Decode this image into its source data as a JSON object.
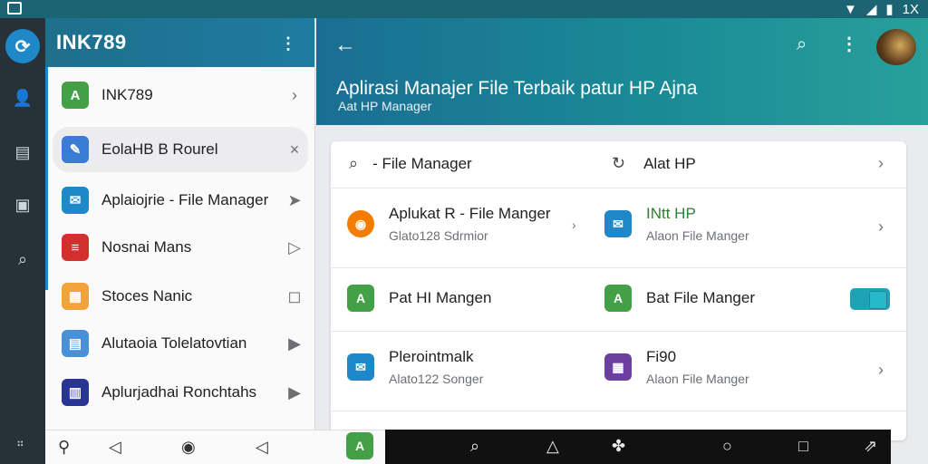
{
  "status_bar": {
    "icons": [
      "image-icon",
      "wifi-icon",
      "signal-icon",
      "battery-icon",
      "close-icon"
    ],
    "right_text": "1X"
  },
  "drawer": {
    "title": "INK789",
    "items": [
      {
        "label": "INK789",
        "icon": "android-icon",
        "color": "#43a047",
        "trail": "›"
      },
      {
        "label": "EolaHB B Rourel",
        "icon": "pen-icon",
        "color": "#3a7bd5",
        "trail": "×"
      },
      {
        "label": "Aplaiojrie - File Manager",
        "icon": "send-icon",
        "color": "#1e88c8",
        "trail": "➤"
      },
      {
        "label": "Nosnai Mans",
        "icon": "doc-icon",
        "color": "#d32f2f",
        "trail": "▷"
      },
      {
        "label": "Stoces Nanic",
        "icon": "grid-icon",
        "color": "#f2a33a",
        "trail": "◻"
      },
      {
        "label": "Alutaoia Tolelatovtian",
        "icon": "calendar-icon",
        "color": "#4a90d9",
        "trail": "▶"
      },
      {
        "label": "Aplurjadhai Ronchtahs",
        "icon": "book-icon",
        "color": "#283593",
        "trail": "▶"
      }
    ]
  },
  "appbar": {
    "title": "Aplirasi Manajer File Terbaik patur HP Ajna",
    "subtitle": "Aat HP Manager"
  },
  "card": {
    "search": {
      "left_label": "- File Manager",
      "right_label": "Alat HP"
    },
    "rows": [
      {
        "left": {
          "title": "Aplukat R - File Manger",
          "sub": "Glato128 Sdrmior",
          "color": "#f57c00"
        },
        "right": {
          "title": "INtt HP",
          "sub": "Alaon File Manger",
          "color": "#1e88c8"
        }
      },
      {
        "left": {
          "title": "Pat HI Mangen",
          "sub": "",
          "color": "#43a047"
        },
        "right": {
          "title": "Bat File Manger",
          "sub": "",
          "color": "#43a047"
        }
      },
      {
        "left": {
          "title": "Plerointmalk",
          "sub": "Alato122 Songer",
          "color": "#1e88c8"
        },
        "right": {
          "title": "Fi90",
          "sub": "Alaon File Manger",
          "color": "#6a3fa0"
        }
      }
    ]
  },
  "colors": {
    "accent": "#1e88c8",
    "appbar_start": "#1a6e93",
    "appbar_end": "#27a09a",
    "rail": "#263238"
  }
}
